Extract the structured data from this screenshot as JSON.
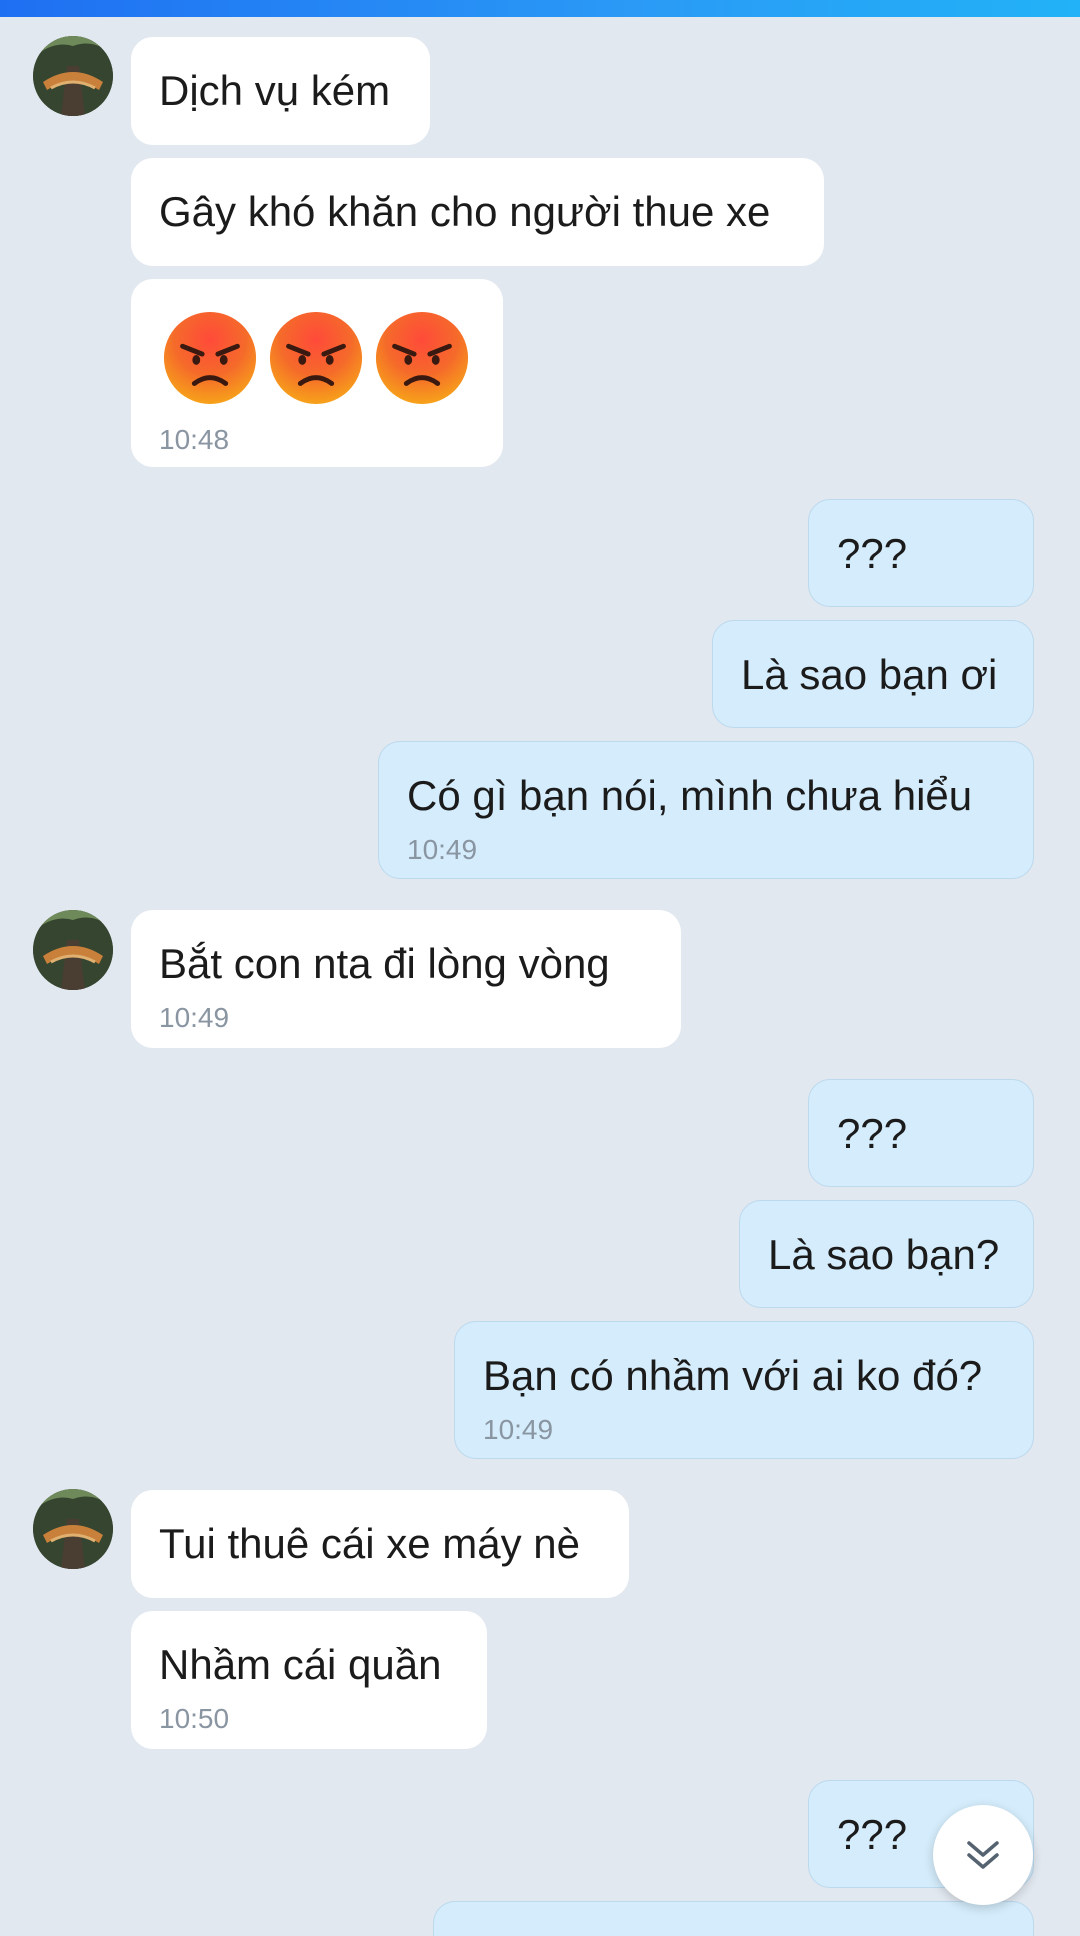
{
  "messages": [
    {
      "text": "Dịch vụ kém"
    },
    {
      "text": "Gây khó khăn cho người thue xe"
    },
    {
      "emoji": "angry-face",
      "time": "10:48"
    },
    {
      "text": "???"
    },
    {
      "text": "Là sao bạn ơi"
    },
    {
      "text": "Có gì bạn nói, mình chưa hiểu",
      "time": "10:49"
    },
    {
      "text": "Bắt con nta đi lòng vòng",
      "time": "10:49"
    },
    {
      "text": "???"
    },
    {
      "text": "Là sao bạn?"
    },
    {
      "text": "Bạn có nhầm với ai ko đó?",
      "time": "10:49"
    },
    {
      "text": "Tui thuê cái xe máy nè"
    },
    {
      "text": "Nhầm cái quần",
      "time": "10:50"
    },
    {
      "text": "???"
    }
  ],
  "icons": {
    "angry_emoji": "angry-face-icon",
    "scroll_down": "double-chevron-down-icon"
  },
  "colors": {
    "background": "#e2e8f0",
    "incoming_bubble": "#ffffff",
    "outgoing_bubble": "#d4ecfb",
    "accent": "#2a9bf6"
  }
}
